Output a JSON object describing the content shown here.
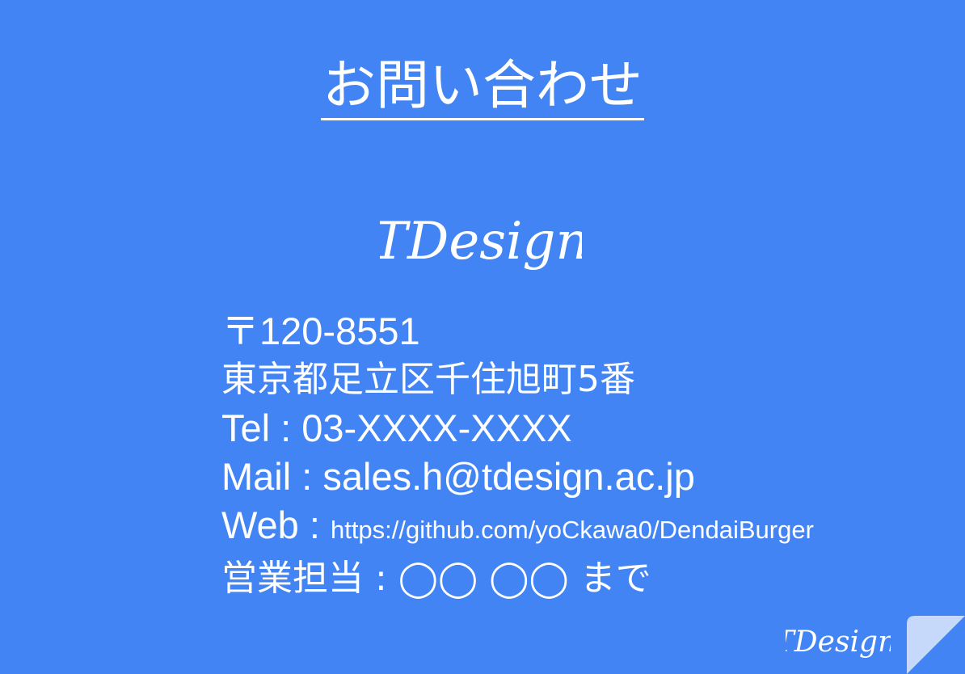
{
  "slide": {
    "title": "お問い合わせ",
    "logo_text": "TDesign",
    "postal": "〒120-8551",
    "address": "東京都足立区千住旭町5番",
    "tel_label": "Tel : ",
    "tel_value": "03-XXXX-XXXX",
    "mail_label": "Mail : ",
    "mail_value": "sales.h@tdesign.ac.jp",
    "web_label": "Web : ",
    "web_value": "https://github.com/yoCkawa0/DendaiBurger",
    "sales_label": "営業担当 : ",
    "sales_value": "◯◯ ◯◯  まで",
    "footer_logo_text": "TDesign"
  },
  "colors": {
    "background": "#4284f3",
    "text": "#ffffff",
    "page_curl": "#c7d9fb"
  }
}
